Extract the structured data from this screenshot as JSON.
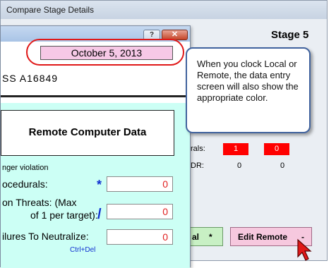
{
  "back_window": {
    "title": "Compare Stage Details",
    "stage": "Stage 5",
    "procedurals_row": {
      "label": "rals:",
      "local": "1",
      "remote": "0"
    },
    "dr_row": {
      "label": "DR:",
      "local": "0",
      "remote": "0"
    },
    "local_button": {
      "label": "al",
      "suffix": "*"
    },
    "edit_remote_button": {
      "label": "Edit Remote",
      "suffix": "-"
    }
  },
  "dialog": {
    "help_glyph": "?",
    "close_glyph": "✕",
    "date": "October  5, 2013",
    "ss_label": "SS   A16849",
    "header": "Remote Computer Data",
    "danger_label": "nger violation",
    "fields": [
      {
        "label": "ocedurals:",
        "marker": "*",
        "value": "0"
      },
      {
        "label_1": "on Threats: (Max",
        "label_2": "of 1 per target):",
        "marker": "/",
        "value": "0"
      },
      {
        "label": "ilures To Neutralize:",
        "value": "0",
        "hint": "Ctrl+Del"
      }
    ]
  },
  "callout": {
    "text": "When you clock Local or Remote, the data entry screen will also show the appropriate color."
  },
  "colors": {
    "remote_accent": "#f6c8de",
    "local_accent": "#c8f0c4",
    "panel": "#ccfff5",
    "highlight_ring": "#e01818"
  }
}
